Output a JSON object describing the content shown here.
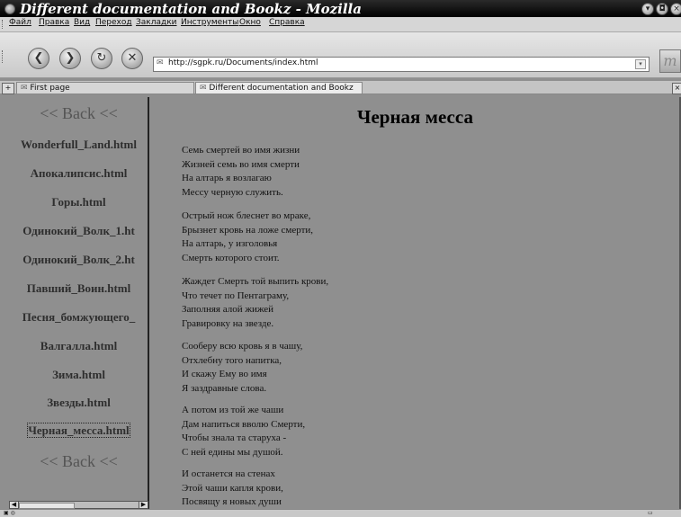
{
  "window": {
    "title": "Different documentation and Bookz - Mozilla"
  },
  "menubar": {
    "items": [
      "Файл",
      "Правка",
      "Вид",
      "Переход",
      "Закладки",
      "Инструменты",
      "Окно",
      "Справка"
    ]
  },
  "navigation": {
    "url": "http://sgpk.ru/Documents/index.html",
    "buttons": [
      "back-icon",
      "forward-icon",
      "reload-icon",
      "stop-icon"
    ]
  },
  "tabs": [
    {
      "label": "First page",
      "active": false
    },
    {
      "label": "Different documentation and Bookz",
      "active": true
    }
  ],
  "sidebar": {
    "back_top": "<< Back <<",
    "links": [
      "Wonderfull_Land.html",
      "Апокалипсис.html",
      "Горы.html",
      "Одинокий_Волк_1.ht",
      "Одинокий_Волк_2.ht",
      "Павший_Воин.html",
      "Песня_бомжующего_",
      "Валгалла.html",
      "Зима.html",
      "Звезды.html",
      "Черная_месса.html"
    ],
    "back_bottom": "<< Back <<"
  },
  "document": {
    "title": "Черная месса",
    "stanzas": [
      [
        "Семь смертей во имя жизни",
        "Жизней семь во имя смерти",
        "На алтарь я возлагаю",
        "Мессу черную служить."
      ],
      [
        "Острый нож блеснет во мраке,",
        "Брызнет кровь на ложе смерти,",
        "На алтарь, у изголовья",
        "Смерть которого стоит."
      ],
      [
        "Жаждет Смерть той выпить крови,",
        "Что течет по Пентаграму,",
        "Заполняя алой жижей",
        "Гравировку на звезде."
      ],
      [
        "Сооберу всю кровь я в чашу,",
        "Отхлебну того напитка,",
        "И скажу Ему во имя",
        "Я заздравные слова."
      ],
      [
        "А потом из той же чаши",
        "Дам напиться вволю Смерти,",
        "Чтобы знала та старуха -",
        "С ней едины мы душой."
      ],
      [
        "И останется на стенах",
        "Этой чаши капля крови,",
        "Посвящу я новых души"
      ]
    ]
  }
}
